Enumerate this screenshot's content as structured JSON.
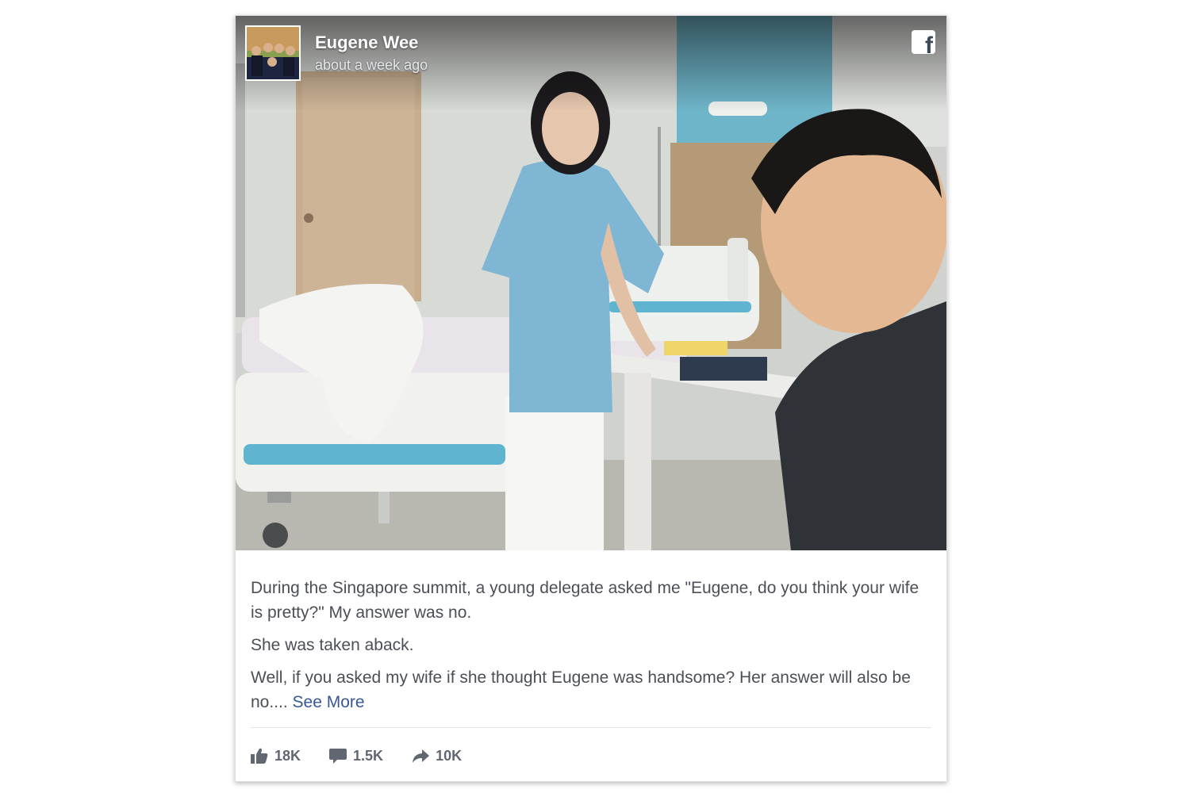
{
  "post": {
    "author": "Eugene Wee",
    "time": "about a week ago",
    "platform_icon": "facebook-icon",
    "body": {
      "p1": "During the Singapore summit, a young delegate asked me \"Eugene, do you think your wife is pretty?\" My answer was no.",
      "p2": "She was taken aback.",
      "p3": "Well, if you asked my wife if she thought Eugene was handsome? Her answer will also be no....",
      "see_more": "See More"
    },
    "stats": {
      "likes": "18K",
      "comments": "1.5K",
      "shares": "10K"
    }
  },
  "colors": {
    "link": "#365899",
    "text": "#4b4f56",
    "stat_text": "#616770",
    "gown": "#7eb6d4",
    "wall_accent": "#6fb5c9"
  }
}
